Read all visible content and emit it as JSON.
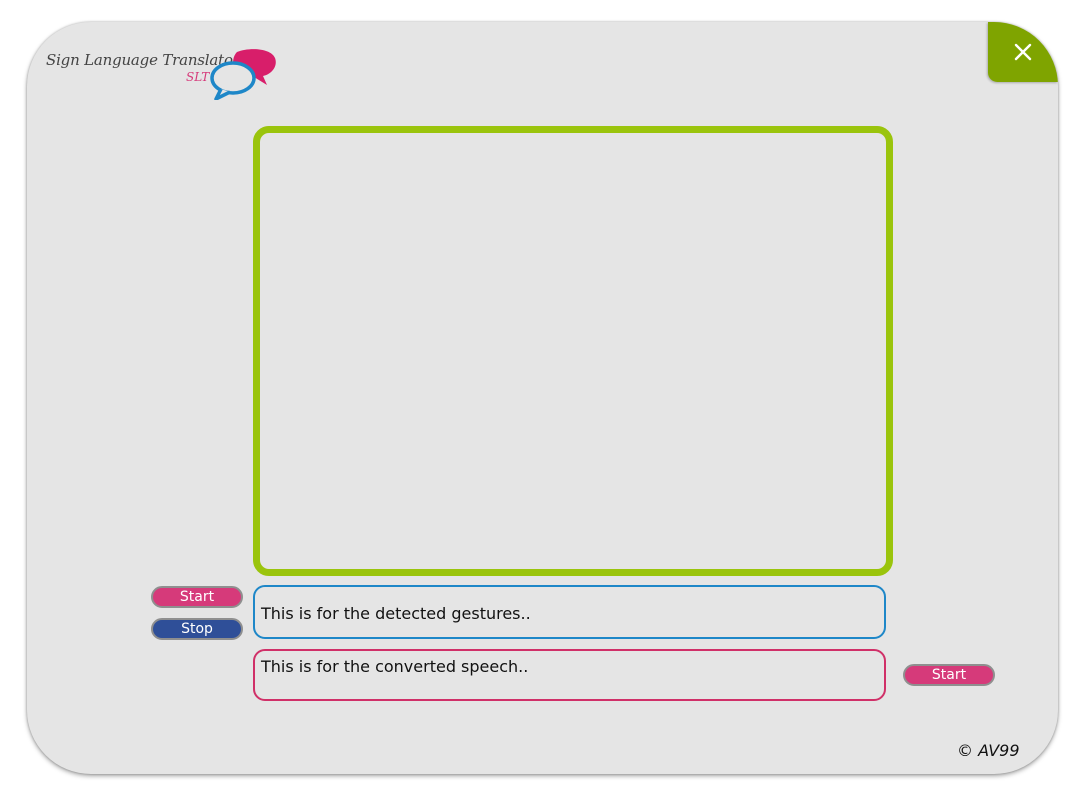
{
  "header": {
    "logo_title": "Sign Language Translator",
    "logo_abbr": "SLT",
    "logo_icon": "speech-bubbles-icon",
    "close_icon": "close-icon"
  },
  "gestures": {
    "text": "This is for the detected gestures..",
    "start_label": "Start",
    "stop_label": "Stop"
  },
  "speech": {
    "text": "This is for the converted speech..",
    "start_label": "Start"
  },
  "footer": {
    "copyright": "© AV99"
  },
  "colors": {
    "background": "#e5e5e5",
    "close_button": "#7fa400",
    "video_border": "#9ac40c",
    "gestures_border": "#1e87c8",
    "speech_border": "#d03068",
    "pink_button": "#d63a7a",
    "blue_button": "#2f4f98"
  }
}
